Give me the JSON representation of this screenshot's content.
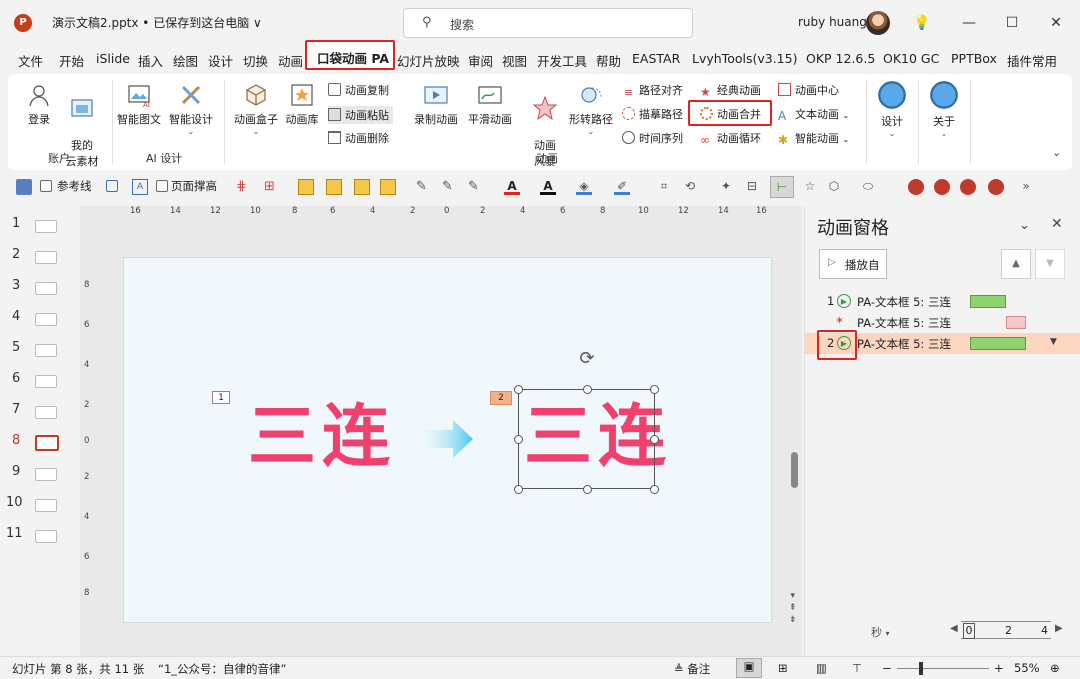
{
  "titlebar": {
    "app_icon": "P",
    "doc_title": "演示文稿2.pptx • 已保存到这台电脑 ∨",
    "search_placeholder": "搜索",
    "user_name": "ruby huang",
    "buttons": {
      "lightbulb": "💡",
      "minimize": "—",
      "maximize": "☐",
      "close": "✕"
    }
  },
  "tabs": [
    "文件",
    "开始",
    "iSlide",
    "插入",
    "绘图",
    "设计",
    "切换",
    "动画",
    "口袋动画 PA",
    "幻灯片放映",
    "审阅",
    "视图",
    "开发工具",
    "帮助",
    "EASTAR",
    "LvyhTools(v3.15)",
    "OKP 12.6.5",
    "OK10 GC",
    "PPTBox",
    "插件常用"
  ],
  "active_tab": "口袋动画 PA",
  "ribbon": {
    "account": {
      "login": "登录",
      "my_assets": "我的\n云素材",
      "label": "账户"
    },
    "ai": {
      "smart_image": "智能图文",
      "smart_design": "智能设计",
      "label": "AI 设计"
    },
    "anim": {
      "box": "动画盒子",
      "lib": "动画库",
      "copy": "动画复制",
      "paste": "动画粘贴",
      "delete": "动画删除",
      "record": "录制动画",
      "smooth": "平滑动画",
      "style": "动画\n风暴",
      "shape_path": "形转路径",
      "path_align": "路径对齐",
      "trace_path": "描摹路径",
      "timeline": "时间序列",
      "classic": "经典动画",
      "merge": "动画合并",
      "loop": "动画循环",
      "center": "动画中心",
      "text": "文本动画",
      "smart": "智能动画",
      "label": "动画"
    },
    "design": "设计",
    "about": "关于"
  },
  "toolbar": {
    "guides": "参考线",
    "page_fill": "页面撑高"
  },
  "slides": {
    "numbers": [
      "1",
      "2",
      "3",
      "4",
      "5",
      "6",
      "7",
      "8",
      "9",
      "10",
      "11"
    ],
    "active": "8"
  },
  "ruler_h": [
    "16",
    "14",
    "12",
    "10",
    "8",
    "6",
    "4",
    "2",
    "0",
    "2",
    "4",
    "6",
    "8",
    "10",
    "12",
    "14",
    "16"
  ],
  "ruler_v": [
    "8",
    "6",
    "4",
    "2",
    "0",
    "2",
    "4",
    "6",
    "8"
  ],
  "slide": {
    "left_text": "三连",
    "right_text": "三连",
    "tag_left": "1",
    "tag_right": "2"
  },
  "anim_pane": {
    "title": "动画窗格",
    "play_label": "播放自",
    "items": [
      {
        "num": "1",
        "label": "PA-文本框 5: 三连",
        "color": "#8fd36f"
      },
      {
        "num": "",
        "label": "PA-文本框 5: 三连",
        "color": "#f9c9c9"
      },
      {
        "num": "2",
        "label": "PA-文本框 5: 三连",
        "color": "#8fd36f"
      }
    ],
    "seconds_label": "秒",
    "timeline": [
      "0",
      "2",
      "4"
    ]
  },
  "status": {
    "slide_info": "幻灯片 第 8 张，共 11 张",
    "note": "“1_公众号：自律的音律”",
    "notes": "备注",
    "zoom": "55%"
  },
  "colors": {
    "accent_red": "#e0231d",
    "text_pink": "#f0406e",
    "selected_row": "#fcd6bf"
  }
}
